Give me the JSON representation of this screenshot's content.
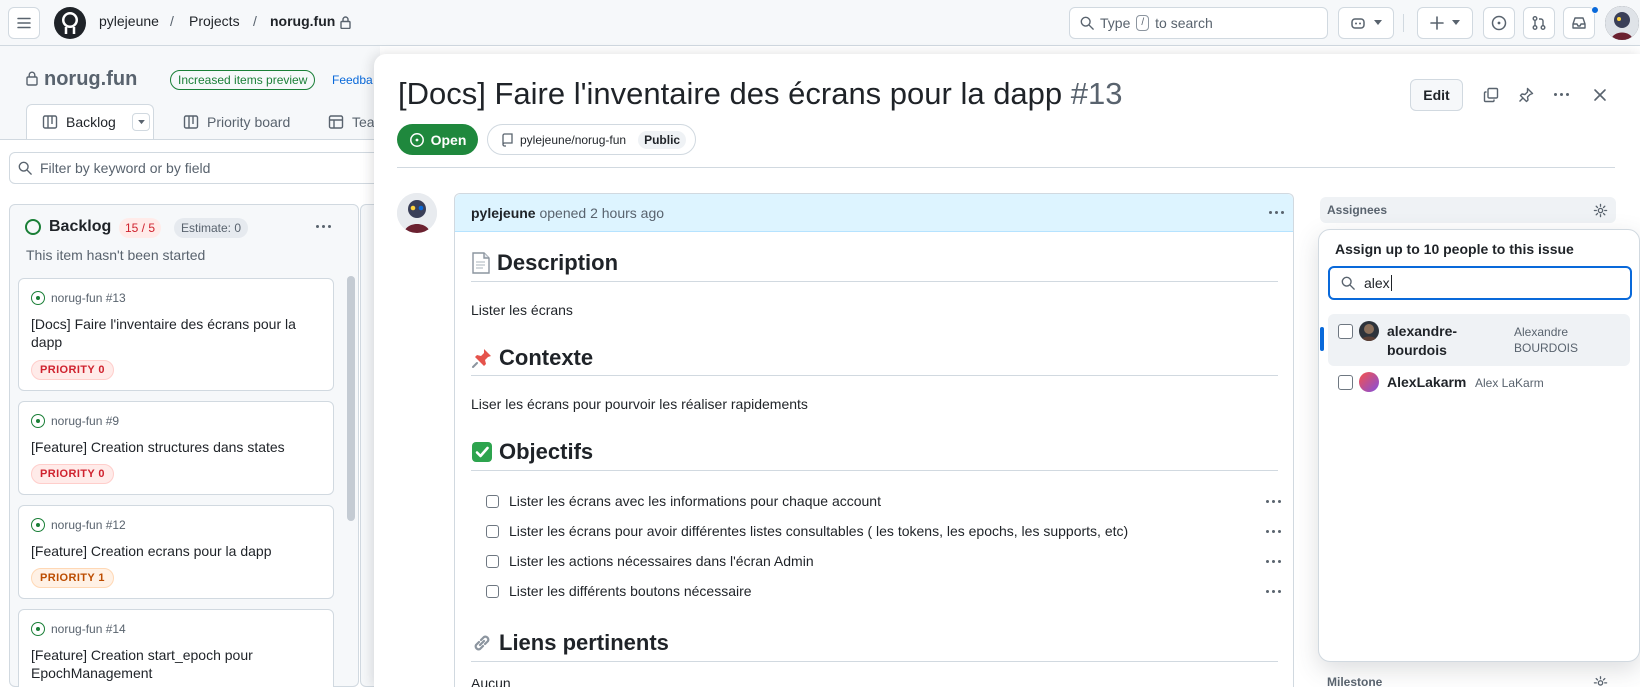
{
  "header": {
    "owner": "pylejeune",
    "projects": "Projects",
    "repo": "norug.fun",
    "search_prefix": "Type",
    "search_key": "/",
    "search_suffix": "to search",
    "sep": "/"
  },
  "project": {
    "title": "norug.fun",
    "preview_badge": "Increased items preview",
    "feedback": "Feedba",
    "tabs": [
      "Backlog",
      "Priority board",
      "Tea"
    ],
    "filter_placeholder": "Filter by keyword or by field",
    "column": {
      "name": "Backlog",
      "count": "15 / 5",
      "estimate": "Estimate: 0",
      "description": "This item hasn't been started"
    },
    "cards": [
      {
        "ref": "norug-fun #13",
        "title": "[Docs] Faire l'inventaire des écrans pour la dapp",
        "priority": "PRIORITY 0"
      },
      {
        "ref": "norug-fun #9",
        "title": "[Feature] Creation structures dans states",
        "priority": "PRIORITY 0"
      },
      {
        "ref": "norug-fun #12",
        "title": "[Feature] Creation ecrans pour la dapp",
        "priority": "PRIORITY 1"
      },
      {
        "ref": "norug-fun #14",
        "title": "[Feature] Creation start_epoch pour EpochManagement",
        "priority": ""
      }
    ]
  },
  "issue": {
    "title": "[Docs] Faire l'inventaire des écrans pour la dapp",
    "number": "#13",
    "status": "Open",
    "repo": "pylejeune/norug-fun",
    "visibility": "Public",
    "edit_label": "Edit",
    "author": "pylejeune",
    "opened_text": "opened 2 hours ago",
    "body": {
      "description_heading": "Description",
      "description_text": "Lister les écrans",
      "context_heading": "Contexte",
      "context_text": "Liser les écrans pour pourvoir les réaliser rapidements",
      "objectives_heading": "Objectifs",
      "tasks": [
        "Lister les écrans avec les informations pour chaque account",
        "Lister les écrans pour avoir différentes listes consultables ( les tokens, les epochs, les supports, etc)",
        "Lister les actions nécessaires dans l'écran Admin",
        "Lister les différents boutons nécessaire"
      ],
      "links_heading": "Liens pertinents",
      "links_text": "Aucun"
    }
  },
  "sidebar": {
    "assignees_label": "Assignees",
    "milestone_label": "Milestone",
    "assign_dropdown": {
      "title": "Assign up to 10 people to this issue",
      "search_value": "alex",
      "results": [
        {
          "login": "alexandre-bourdois",
          "name": "Alexandre BOURDOIS"
        },
        {
          "login": "AlexLakarm",
          "name": "Alex LaKarm"
        }
      ]
    }
  },
  "colors": {
    "open_green": "#1f883d",
    "accent_blue": "#0969da",
    "comment_header": "#ddf4ff"
  }
}
